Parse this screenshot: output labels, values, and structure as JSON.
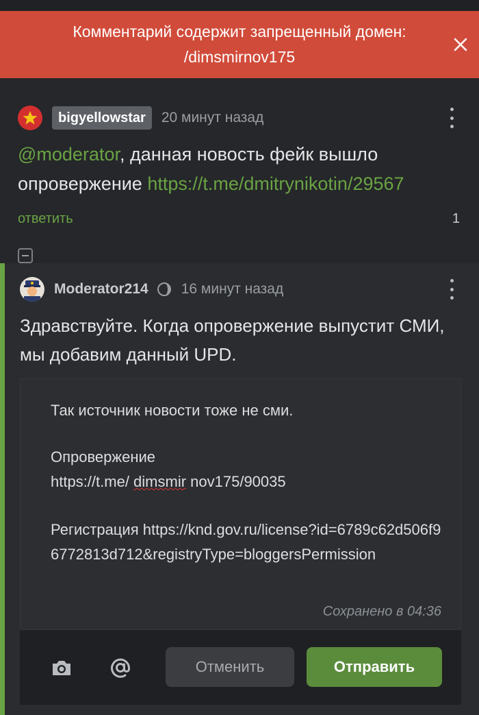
{
  "banner": {
    "message": "Комментарий содержит запрещенный домен: /dimsmirnov175",
    "color": "#d14b3a"
  },
  "comment1": {
    "username": "bigyellowstar",
    "time": "20 минут назад",
    "mention": "@moderator",
    "text": ", данная новость фейк вышло опровержение ",
    "link": "https://t.me/dmitrynikotin/29567",
    "reply_label": "ответить",
    "reply_count": "1"
  },
  "comment2": {
    "username": "Moderator214",
    "time": "16 минут назад",
    "text": "Здравствуйте. Когда опровержение выпустит СМИ, мы добавим данный UPD."
  },
  "editor": {
    "line1": "Так источник новости тоже не сми.",
    "line2_label": "Опровержение",
    "line2_url_a": "https://t.me/ ",
    "line2_url_b": "dimsmir",
    "line2_url_c": " nov175/90035",
    "line3": "Регистрация https://knd.gov.ru/license?id=6789c62d506f96772813d712&registryType=bloggersPermission",
    "saved": "Сохранено в 04:36",
    "cancel_label": "Отменить",
    "send_label": "Отправить"
  },
  "colors": {
    "accent_green": "#6aa343",
    "send_button": "#5b8c3c"
  },
  "icons": [
    "close-icon",
    "star-icon",
    "kebab-icon",
    "minus-icon",
    "moderator-icon",
    "camera-icon",
    "at-icon"
  ]
}
